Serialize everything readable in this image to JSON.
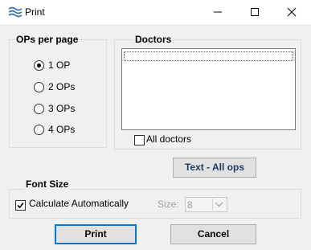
{
  "window": {
    "title": "Print"
  },
  "ops_group": {
    "title": "OPs per page",
    "options": [
      {
        "label": "1 OP",
        "selected": true
      },
      {
        "label": "2 OPs",
        "selected": false
      },
      {
        "label": "3 OPs",
        "selected": false
      },
      {
        "label": "4 OPs",
        "selected": false
      }
    ]
  },
  "doctors_group": {
    "title": "Doctors",
    "all_doctors_label": "All doctors",
    "all_doctors_checked": false
  },
  "text_all_ops_label": "Text - All ops",
  "font_group": {
    "title": "Font Size",
    "calc_auto_label": "Calculate Automatically",
    "calc_auto_checked": true,
    "size_label": "Size:",
    "size_value": "8"
  },
  "buttons": {
    "print": "Print",
    "cancel": "Cancel"
  },
  "colors": {
    "focus_border": "#0078d7",
    "text_ops_color": "#1e3a5f"
  }
}
